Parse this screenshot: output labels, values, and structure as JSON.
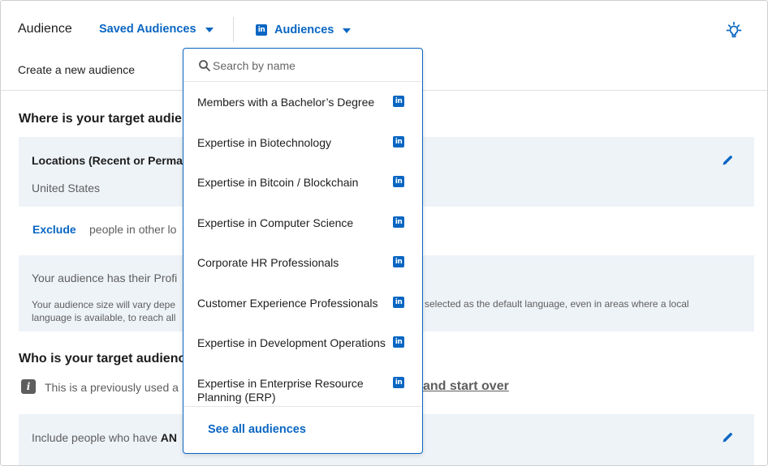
{
  "header": {
    "title": "Audience",
    "saved_audiences_label": "Saved Audiences",
    "audiences_tab_label": "Audiences",
    "create_label": "Create a new audience"
  },
  "main": {
    "where_heading": "Where is your target audien",
    "locations_label": "Locations (Recent or Perma",
    "locations_value": "United States",
    "exclude_label": "Exclude",
    "exclude_text": "people in other lo",
    "profile_text": "Your audience has their Profi",
    "note_left_line1": "Your audience size will vary depe",
    "note_left_line2": "language is available, to reach all",
    "note_right": "e selected as the default language, even in areas where a local",
    "who_heading": "Who is your target audienc",
    "previous_text": "This is a previously used a",
    "start_over_label": "and start over",
    "include_text_prefix": "Include people who have ",
    "include_text_bold": "AN"
  },
  "dropdown": {
    "search_placeholder": "Search by name",
    "options": [
      {
        "label": "Members with a Bachelor’s Degree"
      },
      {
        "label": "Expertise in Biotechnology"
      },
      {
        "label": "Expertise in Bitcoin / Blockchain"
      },
      {
        "label": "Expertise in Computer Science"
      },
      {
        "label": "Corporate HR Professionals"
      },
      {
        "label": "Customer Experience Professionals"
      },
      {
        "label": "Expertise in Development Operations"
      },
      {
        "label": "Expertise in Enterprise Resource Planning (ERP)"
      }
    ],
    "see_all_label": "See all audiences"
  },
  "icons": {
    "linkedin_badge_text": "in",
    "info_icon_text": "i"
  },
  "colors": {
    "accent": "#0a66c2",
    "card_bg": "#eef3f8",
    "muted_text": "#5e5e5e"
  }
}
